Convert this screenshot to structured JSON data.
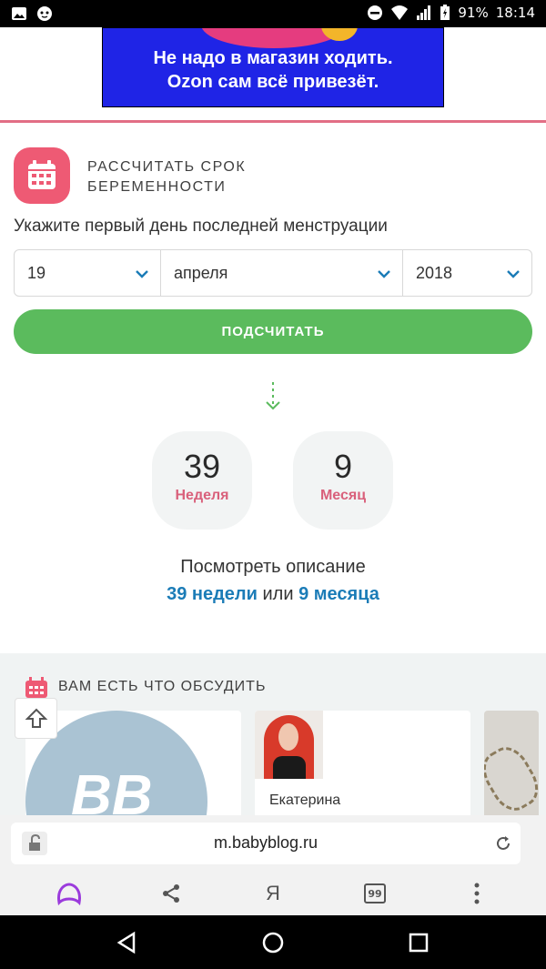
{
  "status_bar": {
    "battery": "91%",
    "time": "18:14"
  },
  "ad": {
    "line1": "Не надо в магазин ходить.",
    "line2": "Ozon сам всё привезёт."
  },
  "calculator": {
    "title_line1": "РАССЧИТАТЬ СРОК",
    "title_line2": "БЕРЕМЕННОСТИ",
    "subtitle": "Укажите первый день последней менструации",
    "day": "19",
    "month": "апреля",
    "year": "2018",
    "button_label": "ПОДСЧИТАТЬ"
  },
  "result": {
    "weeks_value": "39",
    "weeks_label": "Неделя",
    "months_value": "9",
    "months_label": "Месяц",
    "desc_title": "Посмотреть описание",
    "link_weeks": "39 недели",
    "link_or": "или",
    "link_months": "9 месяца"
  },
  "discuss": {
    "title": "ВАМ ЕСТЬ ЧТО ОБСУДИТЬ",
    "cards": [
      {
        "logo_text": "BB"
      },
      {
        "name": "Екатерина"
      }
    ]
  },
  "browser": {
    "url": "m.babyblog.ru",
    "tabs_count": "99",
    "ya_label": "Я"
  },
  "colors": {
    "accent_pink": "#ee5a74",
    "accent_green": "#5bbb5d",
    "link_blue": "#1b7cb7"
  }
}
